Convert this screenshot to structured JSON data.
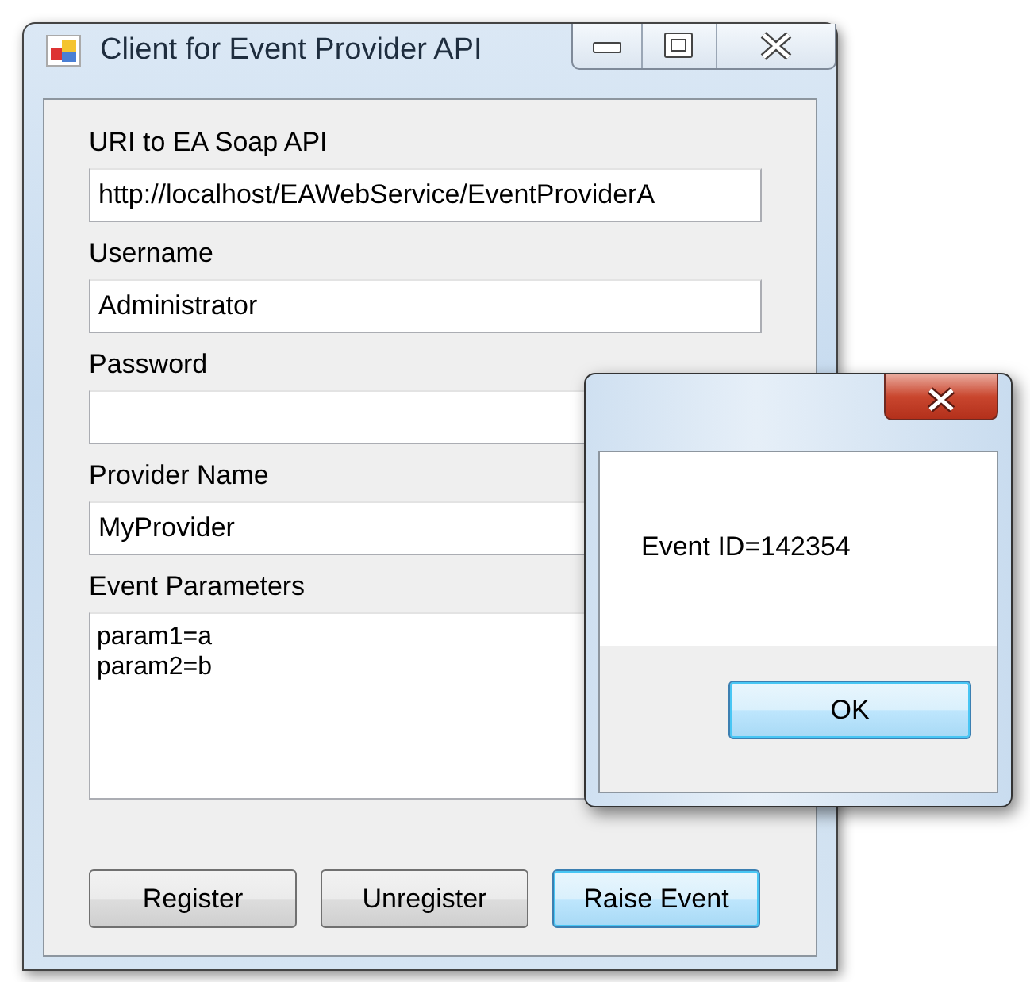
{
  "window": {
    "title": "Client for Event Provider API"
  },
  "fields": [
    {
      "label": "URI to EA Soap API",
      "value": "http://localhost/EAWebService/EventProviderA",
      "kind": "text"
    },
    {
      "label": "Username",
      "value": "Administrator",
      "kind": "text"
    },
    {
      "label": "Password",
      "kind": "password"
    },
    {
      "label": "Provider Name",
      "value": "MyProvider",
      "kind": "text"
    },
    {
      "label": "Event Parameters",
      "value": "param1=a\nparam2=b",
      "kind": "multiline"
    }
  ],
  "buttons": [
    {
      "label": "Register",
      "focused": false
    },
    {
      "label": "Unregister",
      "focused": false
    },
    {
      "label": "Raise Event",
      "focused": true
    }
  ],
  "dialog": {
    "message": "Event ID=142354",
    "buttons": [
      {
        "label": "OK",
        "focused": true
      }
    ]
  }
}
